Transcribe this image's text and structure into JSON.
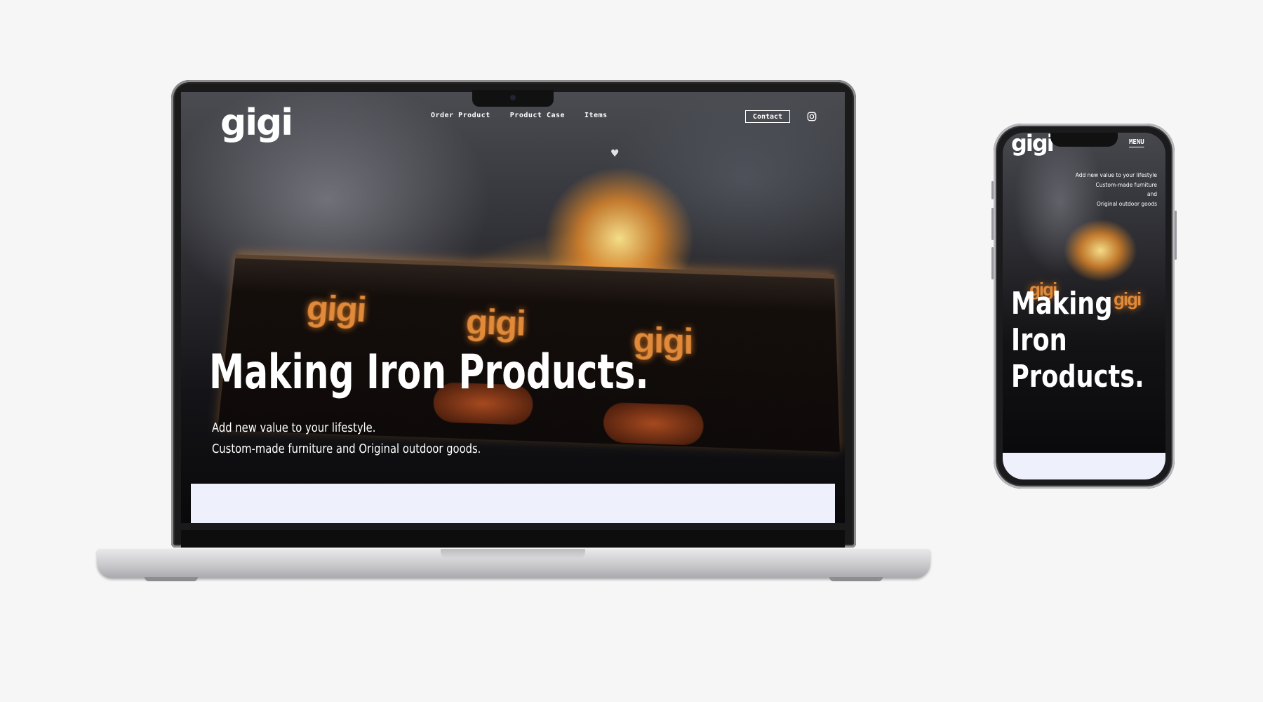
{
  "site": {
    "logo": "gigi",
    "nav": [
      {
        "label": "Order Product"
      },
      {
        "label": "Product Case"
      },
      {
        "label": "Items"
      }
    ],
    "contact_label": "Contact",
    "instagram_icon": "instagram-icon"
  },
  "hero": {
    "heading": "Making Iron Products.",
    "sub_line1": "Add new value to your lifestyle.",
    "sub_line2": "Custom-made furniture and Original outdoor goods."
  },
  "grill": {
    "engraving": "gigi"
  },
  "mobile": {
    "logo": "gigi",
    "menu_label": "MENU",
    "tagline": [
      "Add new value to your lifestyle",
      "Custom-made furniture",
      "and",
      "Original outdoor goods"
    ],
    "heading_lines": [
      "Making",
      "Iron",
      "Products."
    ]
  },
  "colors": {
    "page_background": "#f6f6f6",
    "text_on_hero": "#ffffff",
    "lower_band": "#eef1fb",
    "fire_glow": "#ffb04a"
  }
}
